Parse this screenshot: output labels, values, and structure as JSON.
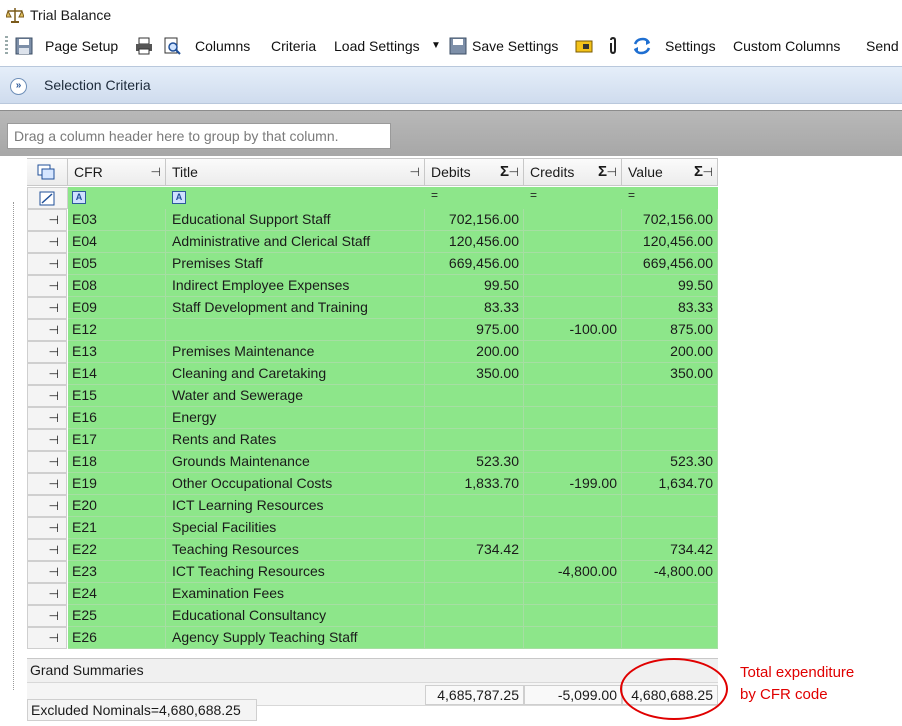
{
  "window": {
    "title": "Trial Balance"
  },
  "toolbar": {
    "page_setup": "Page Setup",
    "columns": "Columns",
    "criteria": "Criteria",
    "load_settings": "Load Settings",
    "save_settings": "Save Settings",
    "settings": "Settings",
    "custom_columns": "Custom Columns",
    "send": "Send"
  },
  "selection": {
    "label": "Selection Criteria"
  },
  "grid": {
    "group_hint": "Drag a column header here to group by that column.",
    "columns": {
      "cfr": "CFR",
      "title": "Title",
      "debits": "Debits",
      "credits": "Credits",
      "value": "Value"
    },
    "rows": [
      {
        "cfr": "E03",
        "title": "Educational Support Staff",
        "debits": "702,156.00",
        "credits": "",
        "value": "702,156.00"
      },
      {
        "cfr": "E04",
        "title": "Administrative and Clerical Staff",
        "debits": "120,456.00",
        "credits": "",
        "value": "120,456.00"
      },
      {
        "cfr": "E05",
        "title": "Premises Staff",
        "debits": "669,456.00",
        "credits": "",
        "value": "669,456.00"
      },
      {
        "cfr": "E08",
        "title": "Indirect Employee Expenses",
        "debits": "99.50",
        "credits": "",
        "value": "99.50"
      },
      {
        "cfr": "E09",
        "title": "Staff Development and Training",
        "debits": "83.33",
        "credits": "",
        "value": "83.33"
      },
      {
        "cfr": "E12",
        "title": "",
        "debits": "975.00",
        "credits": "-100.00",
        "value": "875.00"
      },
      {
        "cfr": "E13",
        "title": "Premises Maintenance",
        "debits": "200.00",
        "credits": "",
        "value": "200.00"
      },
      {
        "cfr": "E14",
        "title": "Cleaning and Caretaking",
        "debits": "350.00",
        "credits": "",
        "value": "350.00"
      },
      {
        "cfr": "E15",
        "title": "Water and Sewerage",
        "debits": "",
        "credits": "",
        "value": ""
      },
      {
        "cfr": "E16",
        "title": "Energy",
        "debits": "",
        "credits": "",
        "value": ""
      },
      {
        "cfr": "E17",
        "title": "Rents and Rates",
        "debits": "",
        "credits": "",
        "value": ""
      },
      {
        "cfr": "E18",
        "title": "Grounds Maintenance",
        "debits": "523.30",
        "credits": "",
        "value": "523.30"
      },
      {
        "cfr": "E19",
        "title": "Other Occupational Costs",
        "debits": "1,833.70",
        "credits": "-199.00",
        "value": "1,634.70"
      },
      {
        "cfr": "E20",
        "title": "ICT Learning Resources",
        "debits": "",
        "credits": "",
        "value": ""
      },
      {
        "cfr": "E21",
        "title": "Special Facilities",
        "debits": "",
        "credits": "",
        "value": ""
      },
      {
        "cfr": "E22",
        "title": "Teaching Resources",
        "debits": "734.42",
        "credits": "",
        "value": "734.42"
      },
      {
        "cfr": "E23",
        "title": "ICT Teaching Resources",
        "debits": "",
        "credits": "-4,800.00",
        "value": "-4,800.00"
      },
      {
        "cfr": "E24",
        "title": "Examination Fees",
        "debits": "",
        "credits": "",
        "value": ""
      },
      {
        "cfr": "E25",
        "title": "Educational Consultancy",
        "debits": "",
        "credits": "",
        "value": ""
      },
      {
        "cfr": "E26",
        "title": "Agency Supply Teaching Staff",
        "debits": "",
        "credits": "",
        "value": ""
      }
    ],
    "summary_label": "Grand Summaries",
    "totals": {
      "debits": "4,685,787.25",
      "credits": "-5,099.00",
      "value": "4,680,688.25"
    },
    "excluded": "Excluded Nominals=4,680,688.25"
  },
  "annotation": {
    "line1": "Total expenditure",
    "line2": "by CFR code",
    "color": "#e00000"
  },
  "colors": {
    "row_green": "#8de68a",
    "header_blue": "#d6e2f2"
  }
}
